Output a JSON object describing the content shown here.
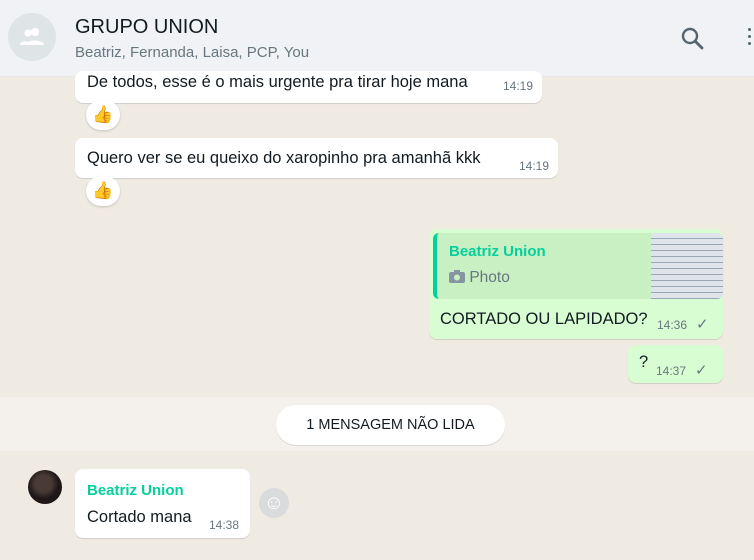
{
  "header": {
    "title": "GRUPO UNION",
    "participants": "Beatriz, Fernanda, Laisa, PCP, You"
  },
  "messages": [
    {
      "text": "De todos, esse é o mais urgente pra tirar hoje mana",
      "time": "14:19",
      "reaction": "👍"
    },
    {
      "text": "Quero ver se eu queixo do xaropinho pra amanhã kkk",
      "time": "14:19",
      "reaction": "👍"
    },
    {
      "quoted_sender": "Beatriz Union",
      "quoted_type": "Photo",
      "text": "CORTADO OU LAPIDADO?",
      "time": "14:36",
      "status": "✓"
    },
    {
      "text": "?",
      "time": "14:37",
      "status": "✓"
    }
  ],
  "unread_divider": "1 MENSAGEM NÃO LIDA",
  "incoming": {
    "sender": "Beatriz Union",
    "text": "Cortado mana",
    "time": "14:38"
  },
  "colors": {
    "outgoing": "#d9fdd3",
    "incoming": "#ffffff",
    "sender_name": "#06cf9c",
    "background": "#efeae2"
  }
}
